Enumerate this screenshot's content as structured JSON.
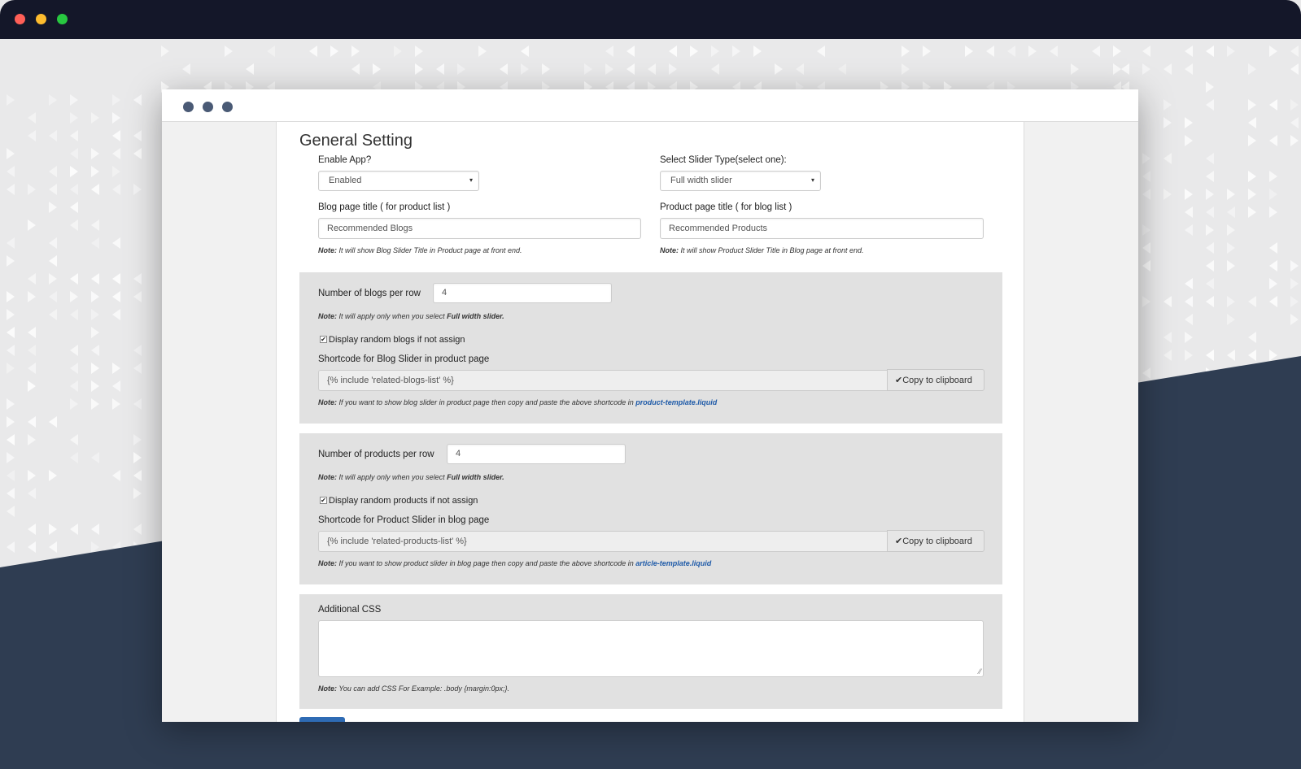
{
  "page": {
    "title": "General Setting"
  },
  "enable_app": {
    "label": "Enable App?",
    "value": "Enabled"
  },
  "slider_type": {
    "label": "Select Slider Type(select one):",
    "value": "Full width slider"
  },
  "blog_title": {
    "label": "Blog page title ( for product list )",
    "value": "Recommended Blogs",
    "note_prefix": "Note:",
    "note_text": "It will show Blog Slider Title in Product page at front end."
  },
  "product_title": {
    "label": "Product page title ( for blog list )",
    "value": "Recommended Products",
    "note_prefix": "Note:",
    "note_text": "It will show Product Slider Title in Blog page at front end."
  },
  "blogs_section": {
    "per_row_label": "Number of blogs per row",
    "per_row_value": "4",
    "note_prefix": "Note:",
    "note_text": "It will apply only when you select",
    "note_bold": "Full width slider.",
    "random_label": "Display random blogs if not assign",
    "random_checked": true,
    "shortcode_label": "Shortcode for Blog Slider in product page",
    "shortcode_value": "{% include 'related-blogs-list' %}",
    "copy_label": "Copy to clipboard",
    "sc_note_prefix": "Note:",
    "sc_note_text": "If you want to show blog slider in product page then copy and paste the above shortcode in",
    "sc_note_link": "product-template.liquid"
  },
  "products_section": {
    "per_row_label": "Number of products per row",
    "per_row_value": "4",
    "note_prefix": "Note:",
    "note_text": "It will apply only when you select",
    "note_bold": "Full width slider.",
    "random_label": "Display random products if not assign",
    "random_checked": true,
    "shortcode_label": "Shortcode for Product Slider in blog page",
    "shortcode_value": "{% include 'related-products-list' %}",
    "copy_label": "Copy to clipboard",
    "sc_note_prefix": "Note:",
    "sc_note_text": "If you want to show product slider in blog page then copy and paste the above shortcode in",
    "sc_note_link": "article-template.liquid"
  },
  "css_section": {
    "label": "Additional CSS",
    "value": "",
    "note_prefix": "Note:",
    "note_text": "You can add CSS For Example: .body {margin:0px;}."
  },
  "icons": {
    "check": "✔",
    "caret": "▾",
    "resize": "⁄⁄"
  },
  "colors": {
    "frame_bar": "#141729",
    "background_dark": "#2f3d52",
    "background_light": "#e9e9ea",
    "accent_link": "#1e5aa8",
    "submit_button": "#2e6bb4"
  }
}
